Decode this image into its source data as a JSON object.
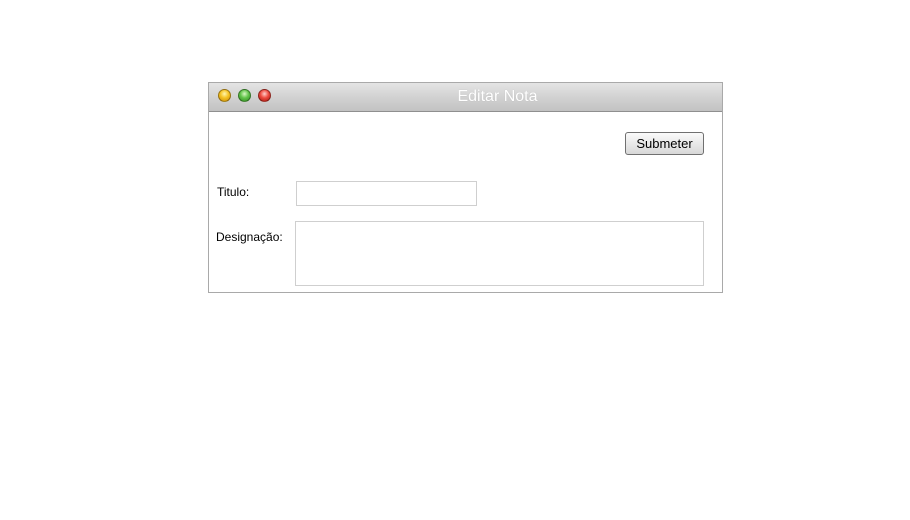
{
  "window": {
    "title": "Editar Nota",
    "controls": [
      {
        "name": "minimize",
        "color": "#f5c324"
      },
      {
        "name": "zoom",
        "color": "#62c44b"
      },
      {
        "name": "close",
        "color": "#ee4b40"
      }
    ]
  },
  "form": {
    "submit_label": "Submeter",
    "title_label": "Titulo:",
    "title_value": "",
    "description_label": "Designação:",
    "description_value": ""
  }
}
